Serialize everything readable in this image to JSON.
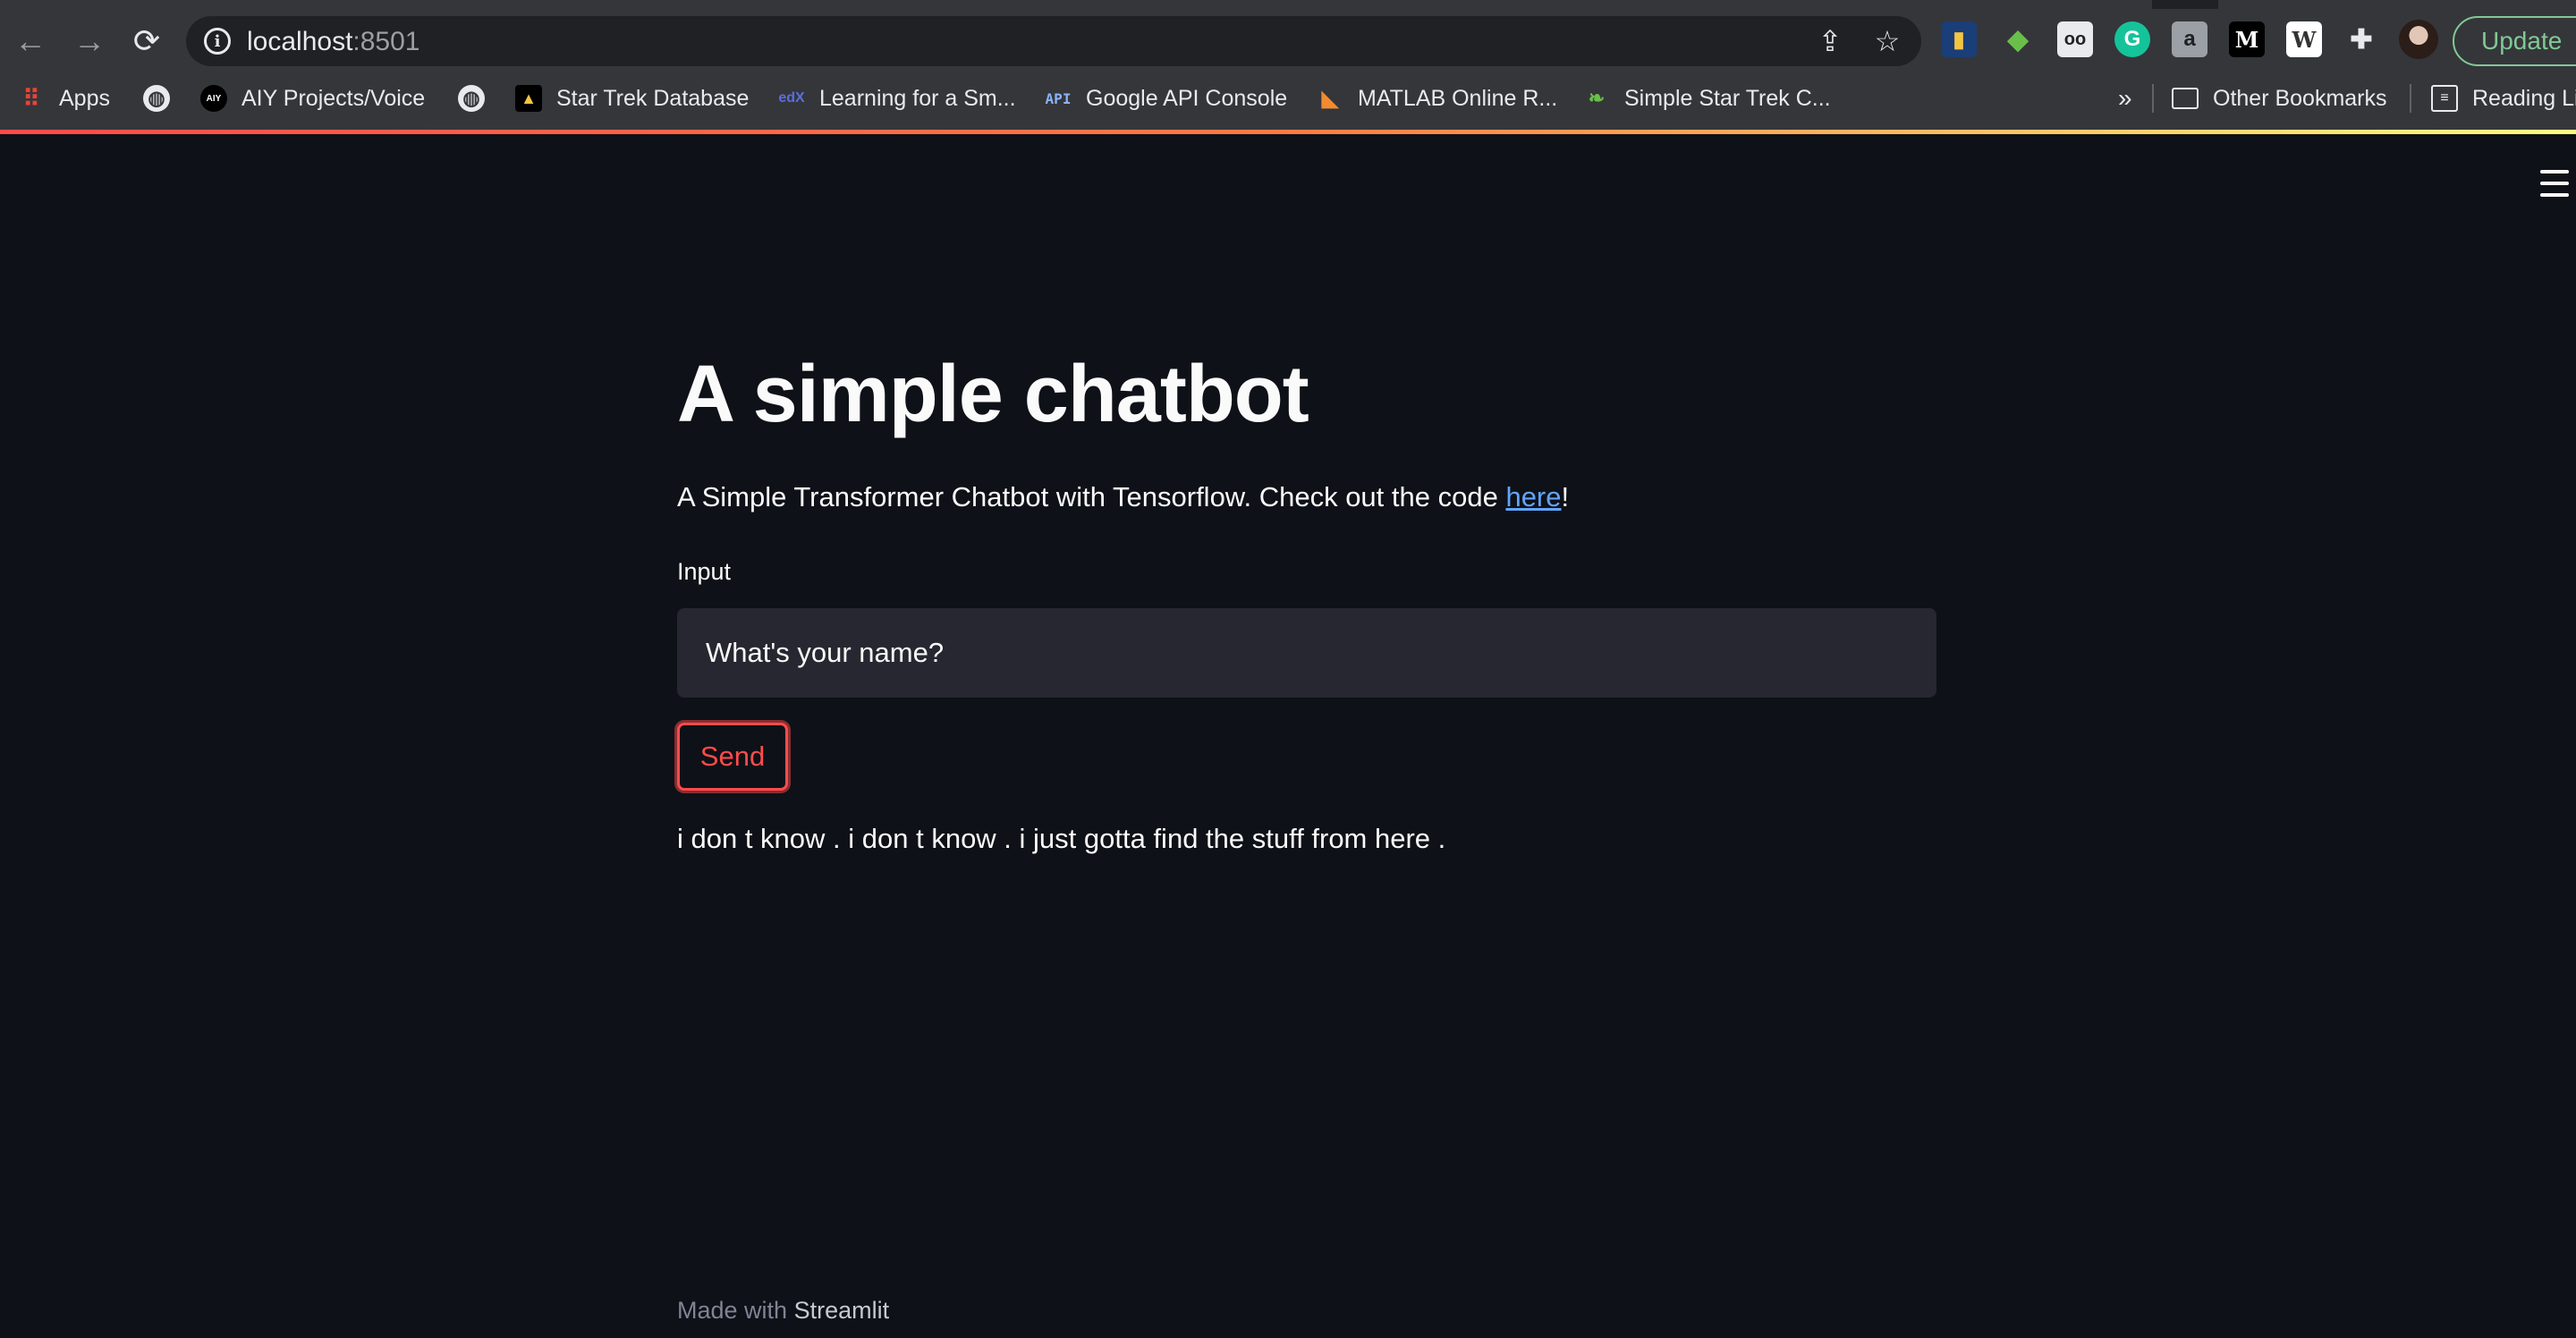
{
  "browser": {
    "url_host": "localhost",
    "url_port": ":8501",
    "update_label": "Update",
    "bookmarks": [
      {
        "label": "Apps",
        "icon": "apps-grid-icon"
      },
      {
        "label": "",
        "icon": "globe-icon"
      },
      {
        "label": "AIY Projects/Voice",
        "icon": "aiy-icon"
      },
      {
        "label": "",
        "icon": "globe-icon"
      },
      {
        "label": "Star Trek Database",
        "icon": "star-trek-icon"
      },
      {
        "label": "Learning for a Sm...",
        "icon": "edx-icon"
      },
      {
        "label": "Google API Console",
        "icon": "api-icon"
      },
      {
        "label": "MATLAB Online R...",
        "icon": "matlab-icon"
      },
      {
        "label": "Simple Star Trek C...",
        "icon": "leaf-icon"
      }
    ],
    "overflow_label": "»",
    "other_bookmarks_label": "Other Bookmarks",
    "reading_list_label": "Reading Li",
    "extensions": [
      "chart-extension-icon",
      "green-cube-extension-icon",
      "glasses-extension-icon",
      "grammarly-extension-icon",
      "a-extension-icon",
      "medium-extension-icon",
      "w-extension-icon",
      "puzzle-icon"
    ]
  },
  "app": {
    "title": "A simple chatbot",
    "subtitle_prefix": "A Simple Transformer Chatbot with Tensorflow. Check out the code ",
    "subtitle_link": "here",
    "subtitle_suffix": "!",
    "input_label": "Input",
    "input_value": "What's your name?",
    "send_label": "Send",
    "response": "i don t know . i don t know . i just gotta find the stuff from here .",
    "footer_prefix": "Made with ",
    "footer_brand": "Streamlit"
  },
  "colors": {
    "background": "#0e1117",
    "input_bg": "#262730",
    "primary": "#ff4b4b",
    "link": "#60a5fa"
  }
}
